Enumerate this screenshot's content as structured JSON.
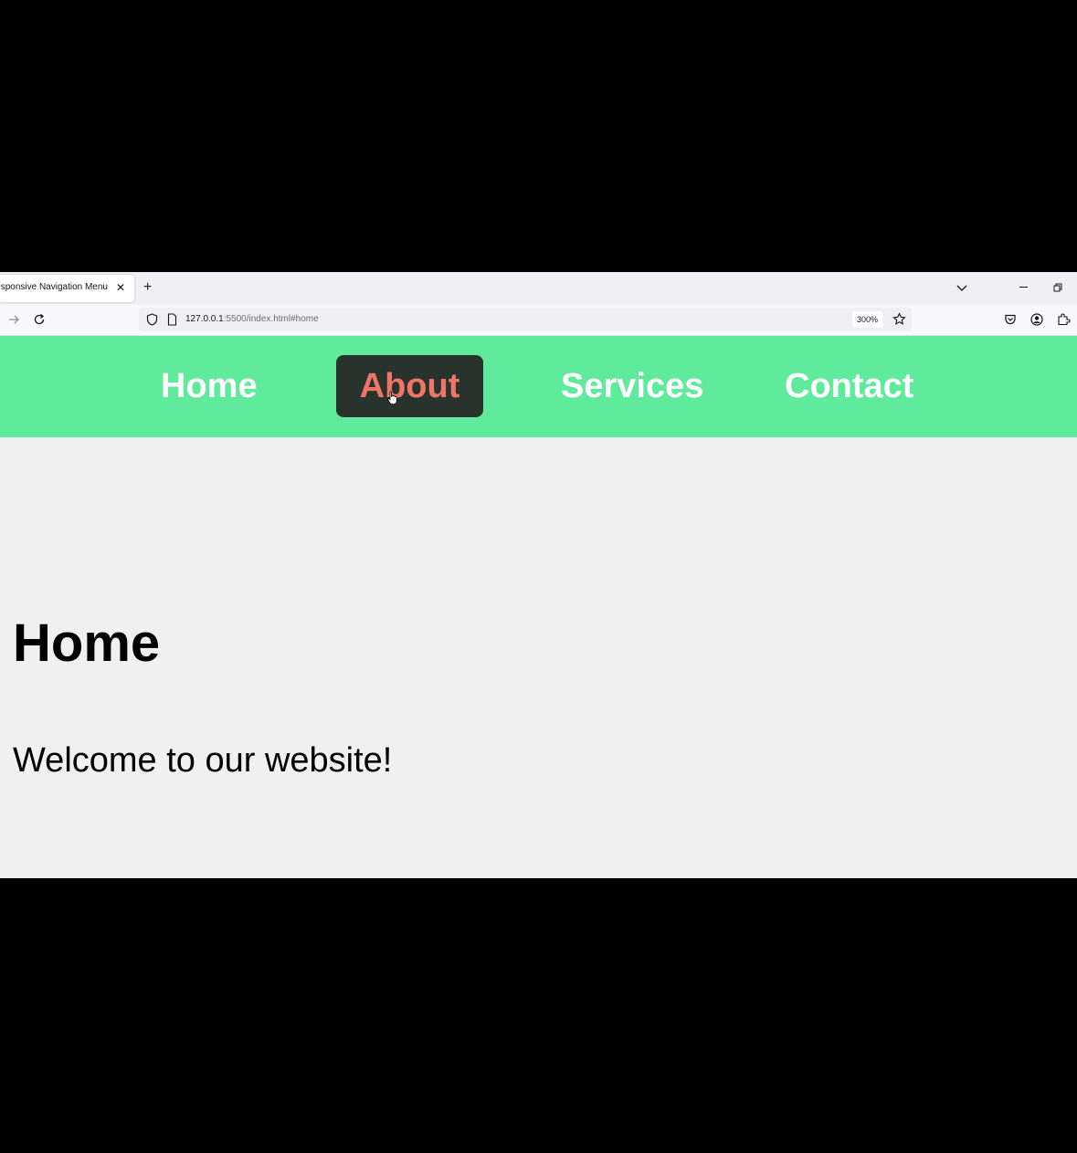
{
  "browser": {
    "tab_title": "Responsive Navigation Menu",
    "tab_close_glyph": "✕",
    "new_tab_glyph": "+",
    "url_host": "127.0.0.1",
    "url_path": ":5500/index.html#home",
    "zoom": "300%"
  },
  "nav": {
    "background_color": "#5fea9c",
    "items": [
      {
        "label": "Home"
      },
      {
        "label": "About",
        "hovered": true
      },
      {
        "label": "Services"
      },
      {
        "label": "Contact"
      }
    ],
    "hover_background": "#29332e",
    "hover_text_color": "#f07468"
  },
  "section": {
    "title": "Home",
    "text": "Welcome to our website!"
  }
}
